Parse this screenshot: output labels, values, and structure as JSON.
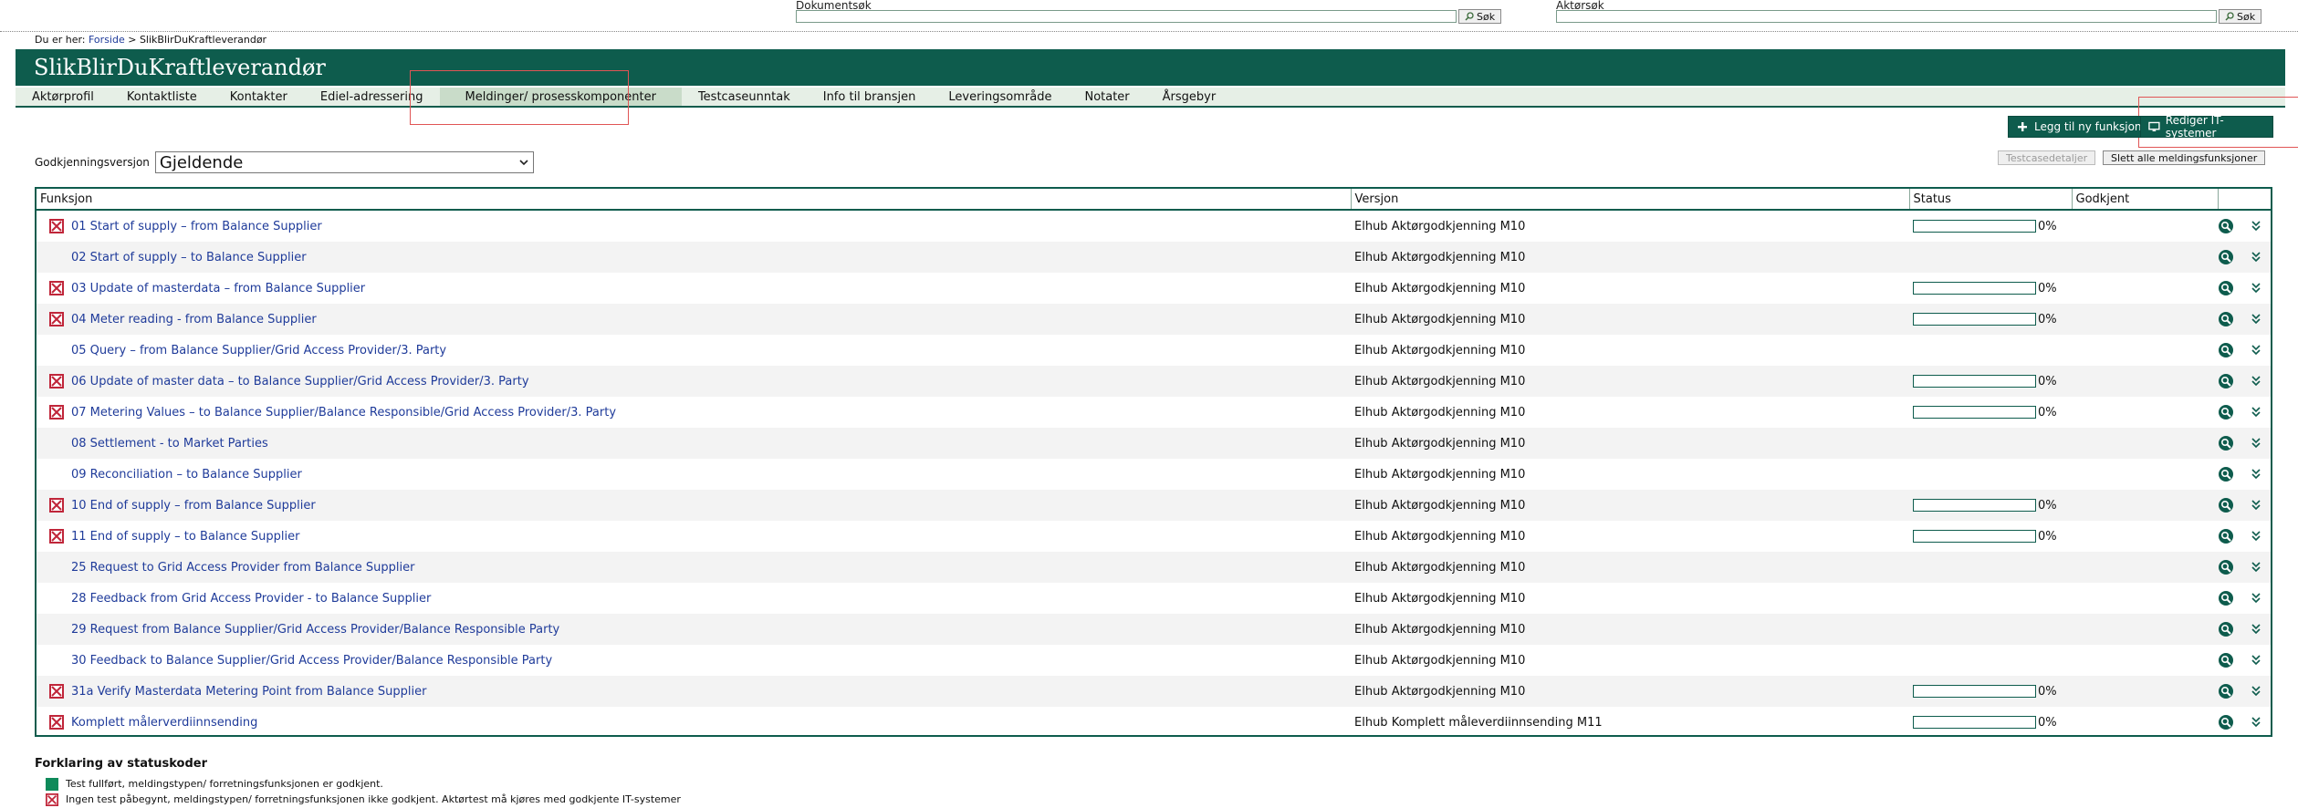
{
  "search": {
    "doc_label": "Dokumentsøk",
    "actor_label": "Aktørsøk",
    "button_label": "Søk"
  },
  "breadcrumb": {
    "prefix": "Du er her:",
    "home": "Forside",
    "separator": ">",
    "current": "SlikBlirDuKraftleverandør"
  },
  "banner": {
    "title": "SlikBlirDuKraftleverandør"
  },
  "nav": {
    "items": [
      "Aktørprofil",
      "Kontaktliste",
      "Kontakter",
      "Ediel-adressering",
      "Meldinger/ prosesskomponenter",
      "Testcaseunntak",
      "Info til bransjen",
      "Leveringsområde",
      "Notater",
      "Årsgebyr"
    ],
    "active_index": 4
  },
  "actions": {
    "add_function": "Legg til ny funksjon",
    "edit_it_systems": "Rediger IT-systemer",
    "testcase_details": "Testcasedetaljer",
    "delete_all": "Slett alle meldingsfunksjoner"
  },
  "version": {
    "label": "Godkjenningsversjon",
    "selected": "Gjeldende"
  },
  "table": {
    "headers": [
      "Funksjon",
      "Versjon",
      "Status",
      "Godkjent",
      ""
    ],
    "rows": [
      {
        "name": "01 Start of supply – from Balance Supplier",
        "version": "Elhub Aktørgodkjenning M10",
        "has_status": true,
        "progress": "0%"
      },
      {
        "name": "02 Start of supply – to Balance Supplier",
        "version": "Elhub Aktørgodkjenning M10",
        "has_status": false,
        "progress": ""
      },
      {
        "name": "03 Update of masterdata – from Balance Supplier",
        "version": "Elhub Aktørgodkjenning M10",
        "has_status": true,
        "progress": "0%"
      },
      {
        "name": "04 Meter reading - from Balance Supplier",
        "version": "Elhub Aktørgodkjenning M10",
        "has_status": true,
        "progress": "0%"
      },
      {
        "name": "05 Query – from Balance Supplier/Grid Access Provider/3. Party",
        "version": "Elhub Aktørgodkjenning M10",
        "has_status": false,
        "progress": ""
      },
      {
        "name": "06 Update of master data – to Balance Supplier/Grid Access Provider/3. Party",
        "version": "Elhub Aktørgodkjenning M10",
        "has_status": true,
        "progress": "0%"
      },
      {
        "name": "07 Metering Values – to Balance Supplier/Balance Responsible/Grid Access Provider/3. Party",
        "version": "Elhub Aktørgodkjenning M10",
        "has_status": true,
        "progress": "0%"
      },
      {
        "name": "08 Settlement - to Market Parties",
        "version": "Elhub Aktørgodkjenning M10",
        "has_status": false,
        "progress": ""
      },
      {
        "name": "09 Reconciliation – to Balance Supplier",
        "version": "Elhub Aktørgodkjenning M10",
        "has_status": false,
        "progress": ""
      },
      {
        "name": "10 End of supply – from Balance Supplier",
        "version": "Elhub Aktørgodkjenning M10",
        "has_status": true,
        "progress": "0%"
      },
      {
        "name": "11 End of supply – to Balance Supplier",
        "version": "Elhub Aktørgodkjenning M10",
        "has_status": true,
        "progress": "0%"
      },
      {
        "name": "25 Request to Grid Access Provider from Balance Supplier",
        "version": "Elhub Aktørgodkjenning M10",
        "has_status": false,
        "progress": ""
      },
      {
        "name": "28 Feedback from Grid Access Provider - to Balance Supplier",
        "version": "Elhub Aktørgodkjenning M10",
        "has_status": false,
        "progress": ""
      },
      {
        "name": "29 Request from Balance Supplier/Grid Access Provider/Balance Responsible Party",
        "version": "Elhub Aktørgodkjenning M10",
        "has_status": false,
        "progress": ""
      },
      {
        "name": "30 Feedback to Balance Supplier/Grid Access Provider/Balance Responsible Party",
        "version": "Elhub Aktørgodkjenning M10",
        "has_status": false,
        "progress": ""
      },
      {
        "name": "31a Verify Masterdata Metering Point from Balance Supplier",
        "version": "Elhub Aktørgodkjenning M10",
        "has_status": true,
        "progress": "0%"
      },
      {
        "name": "Komplett målerverdiinnsending",
        "version": "Elhub Komplett måleverdiinnsending M11",
        "has_status": true,
        "progress": "0%"
      }
    ]
  },
  "legend": {
    "title": "Forklaring av statuskoder",
    "completed": "Test fullført, meldingstypen/ forretningsfunksjonen er godkjent.",
    "not_started": "Ingen test påbegynt, meldingstypen/ forretningsfunksjonen ikke godkjent. Aktørtest må kjøres med godkjente IT-systemer"
  },
  "colors": {
    "brand": "#0e5c4d",
    "link": "#1f3b9a",
    "error": "#c0263a"
  }
}
